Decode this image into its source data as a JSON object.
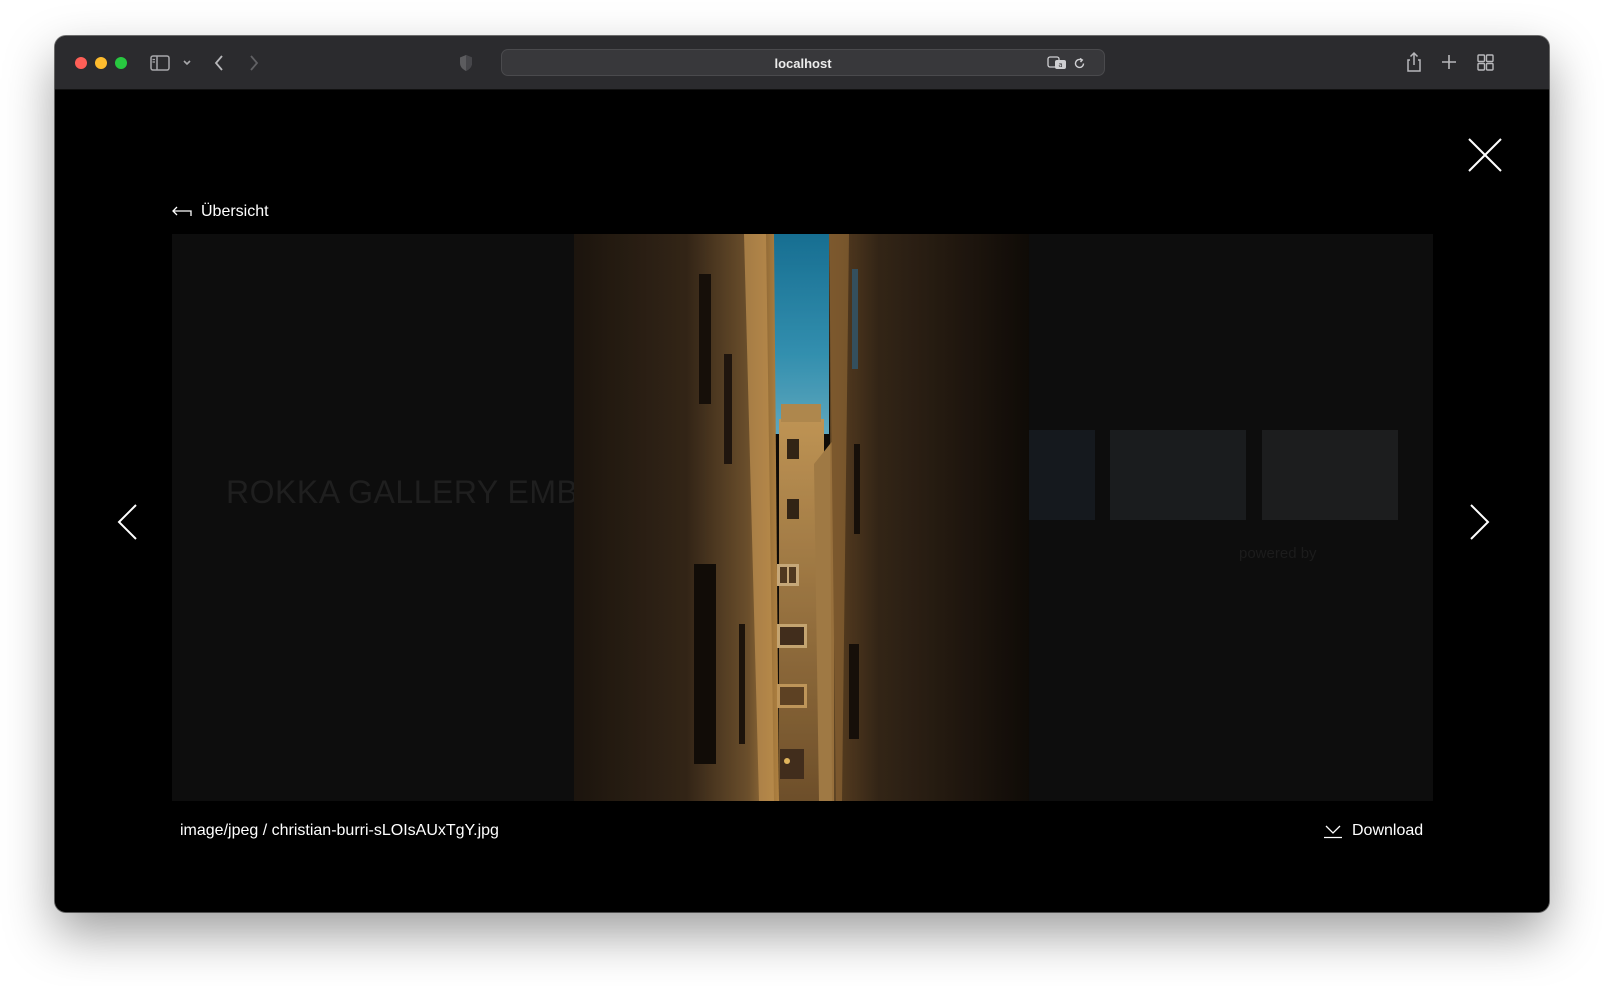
{
  "browser": {
    "url": "localhost"
  },
  "lightbox": {
    "back_label": "Übersicht",
    "file_info": "image/jpeg / christian-burri-sLOIsAUxTgY.jpg",
    "download_label": "Download"
  },
  "background_page": {
    "title": "ROKKA GALLERY EMBED",
    "powered_by": "powered by"
  },
  "colors": {
    "toolbar": "#2b2b2e",
    "overlay": "#000000",
    "stage": "#0d0d0d",
    "sky": "#1e8fb4",
    "wall_warm": "#c9944a"
  }
}
